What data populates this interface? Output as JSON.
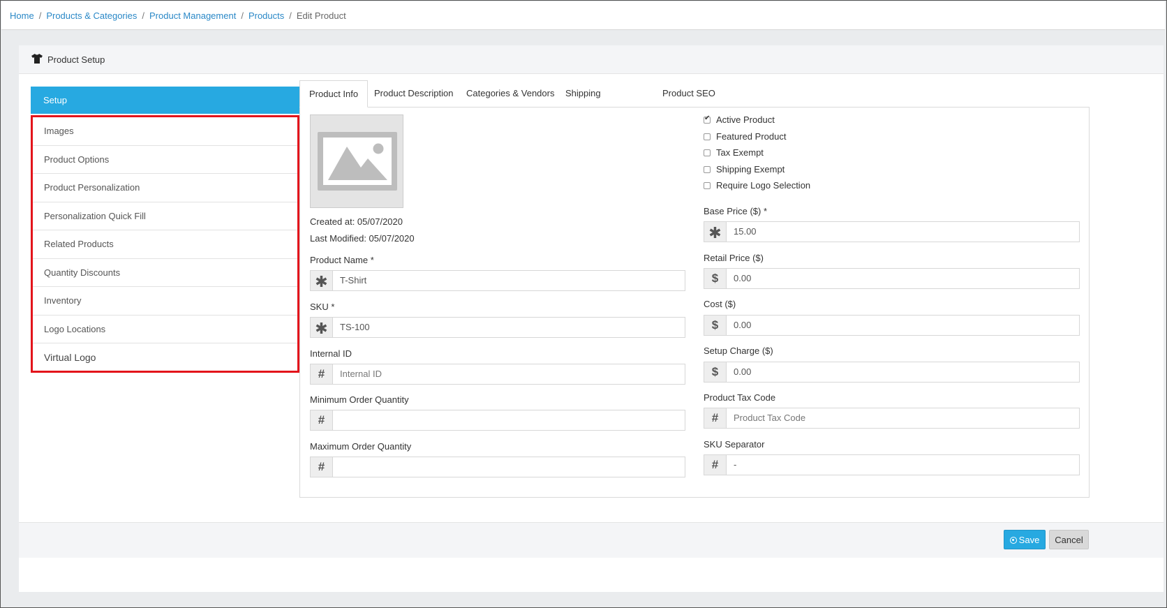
{
  "breadcrumb": {
    "items": [
      "Home",
      "Products & Categories",
      "Product Management",
      "Products"
    ],
    "current": "Edit Product",
    "separator": "/"
  },
  "panel": {
    "title": "Product Setup",
    "icon": "tshirt-icon"
  },
  "menu": {
    "active": "Setup",
    "items": [
      "Images",
      "Product Options",
      "Product Personalization",
      "Personalization Quick Fill",
      "Related Products",
      "Quantity Discounts",
      "Inventory",
      "Logo Locations",
      "Virtual Logo"
    ]
  },
  "tabs": [
    "Product Info",
    "Product Description",
    "Categories & Vendors",
    "Shipping",
    "Product SEO"
  ],
  "active_tab": "Product Info",
  "info": {
    "created": "Created at: 05/07/2020",
    "modified": "Last Modified: 05/07/2020"
  },
  "left_fields": {
    "product_name": {
      "label": "Product Name *",
      "value": "T-Shirt",
      "icon": "asterisk-icon"
    },
    "sku": {
      "label": "SKU *",
      "value": "TS-100",
      "icon": "asterisk-icon"
    },
    "internal_id": {
      "label": "Internal ID",
      "value": "",
      "placeholder": "Internal ID",
      "icon": "hash-icon"
    },
    "min_qty": {
      "label": "Minimum Order Quantity",
      "value": "",
      "icon": "hash-icon"
    },
    "max_qty": {
      "label": "Maximum Order Quantity",
      "value": "",
      "icon": "hash-icon"
    }
  },
  "checkboxes": [
    {
      "label": "Active Product",
      "checked": true
    },
    {
      "label": "Featured Product",
      "checked": false
    },
    {
      "label": "Tax Exempt",
      "checked": false
    },
    {
      "label": "Shipping Exempt",
      "checked": false
    },
    {
      "label": "Require Logo Selection",
      "checked": false
    }
  ],
  "right_fields": {
    "base_price": {
      "label": "Base Price ($) *",
      "value": "15.00",
      "icon": "asterisk-icon"
    },
    "retail_price": {
      "label": "Retail Price ($)",
      "value": "0.00",
      "icon": "dollar-icon"
    },
    "cost": {
      "label": "Cost ($)",
      "value": "0.00",
      "icon": "dollar-icon"
    },
    "setup_charge": {
      "label": "Setup Charge ($)",
      "value": "0.00",
      "icon": "dollar-icon"
    },
    "tax_code": {
      "label": "Product Tax Code",
      "value": "",
      "placeholder": "Product Tax Code",
      "icon": "hash-icon"
    },
    "sku_separator": {
      "label": "SKU Separator",
      "value": "-",
      "icon": "hash-icon"
    }
  },
  "icons": {
    "asterisk": "✱",
    "dollar": "$",
    "hash": "#"
  },
  "buttons": {
    "save": "Save",
    "cancel": "Cancel"
  },
  "colors": {
    "accent": "#27a9e1",
    "highlight_border": "#e3141b",
    "link": "#2a88c7"
  }
}
